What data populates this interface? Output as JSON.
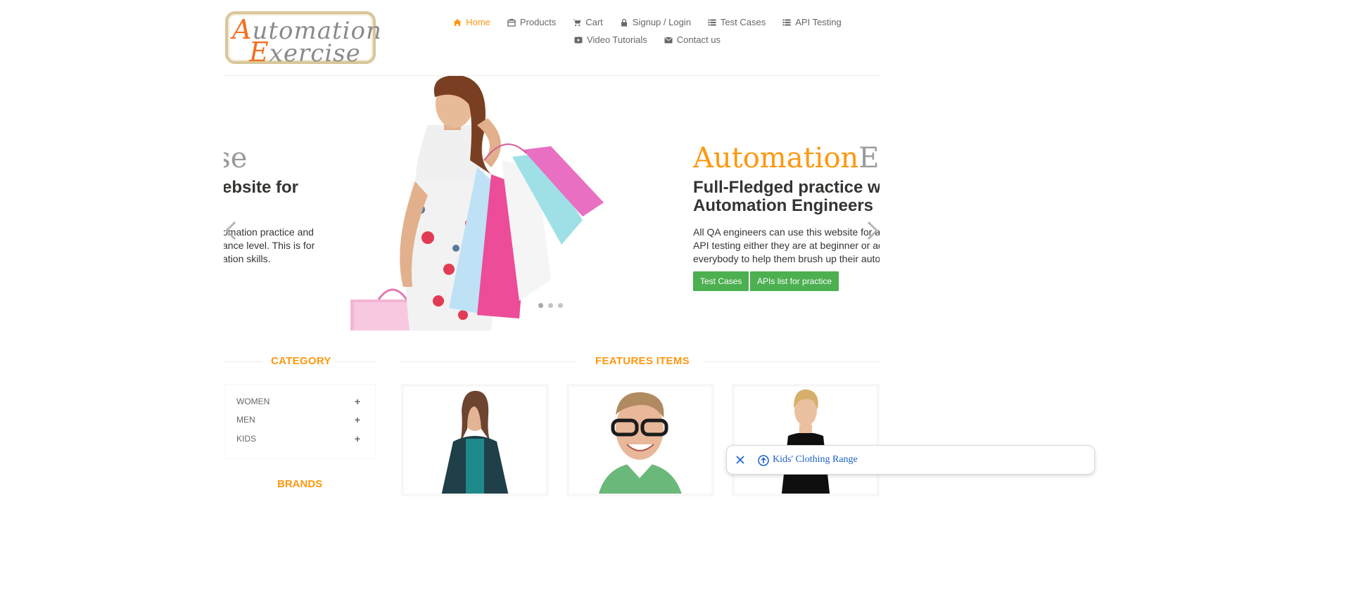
{
  "logo": {
    "line1_cap": "A",
    "line1_rest": "utomation",
    "line2_cap": "E",
    "line2_rest": "xercise"
  },
  "nav": {
    "items": [
      {
        "label": "Home",
        "icon": "home-icon",
        "active": true
      },
      {
        "label": "Products",
        "icon": "product-bag-icon"
      },
      {
        "label": "Cart",
        "icon": "cart-icon"
      },
      {
        "label": "Signup / Login",
        "icon": "lock-icon"
      },
      {
        "label": "Test Cases",
        "icon": "list-icon"
      },
      {
        "label": "API Testing",
        "icon": "list-icon"
      },
      {
        "label": "Video Tutorials",
        "icon": "youtube-play-icon"
      },
      {
        "label": "Contact us",
        "icon": "envelope-icon"
      }
    ]
  },
  "slider": {
    "left": {
      "brand_fragment": "cise",
      "heading_fragment": "ebsite for",
      "text_lines": [
        "omation practice and",
        "ance level. This is for",
        "ation skills."
      ]
    },
    "right": {
      "brand_orange": "Automation",
      "brand_gray": "Exerc",
      "heading_line1": "Full-Fledged practice we",
      "heading_line2": "Automation Engineers",
      "text_lines": [
        "All QA engineers can use this website for auto",
        "API testing either they are at beginner or adva",
        "everybody to help them brush up their automa"
      ],
      "btn_test_cases": "Test Cases",
      "btn_apis": "APIs list for practice"
    },
    "dots": 3,
    "active_dot": 0
  },
  "sidebar": {
    "category_title": "CATEGORY",
    "categories": [
      {
        "label": "WOMEN",
        "toggle": "+"
      },
      {
        "label": "MEN",
        "toggle": "+"
      },
      {
        "label": "KIDS",
        "toggle": "+"
      }
    ],
    "brands_title": "BRANDS"
  },
  "features": {
    "title": "FEATURES ITEMS"
  },
  "toast": {
    "text": "Kids' Clothing Range"
  },
  "colors": {
    "accent": "#fe980f",
    "button_green": "#4caf50",
    "text": "#696763",
    "link_blue": "#1a5fc8"
  }
}
